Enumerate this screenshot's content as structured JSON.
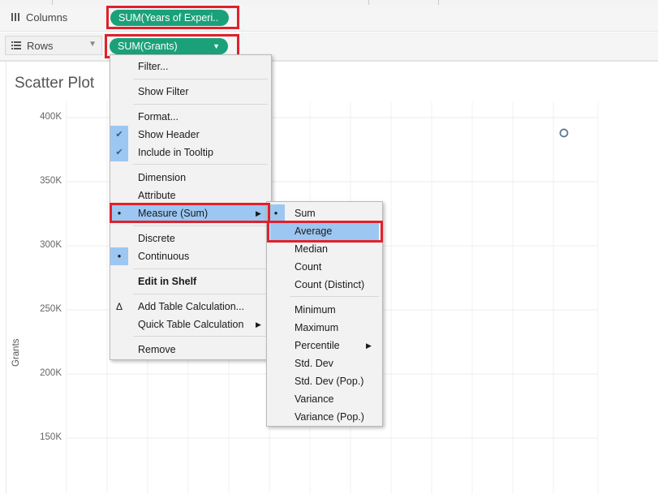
{
  "shelves": {
    "columns": {
      "label": "Columns",
      "icon": "columns-icon",
      "pill": "SUM(Years of Experi.."
    },
    "rows": {
      "label": "Rows",
      "icon": "rows-icon",
      "pill": "SUM(Grants)"
    }
  },
  "view": {
    "title": "Scatter Plot",
    "y_axis_label": "Grants"
  },
  "chart_data": {
    "type": "scatter",
    "title": "Scatter Plot",
    "ylabel": "Grants",
    "y_ticks": [
      "400K",
      "350K",
      "300K",
      "250K",
      "200K",
      "150K"
    ],
    "ylim": [
      130000,
      410000
    ],
    "points": [
      {
        "y": 388000
      }
    ],
    "grid": true
  },
  "context_menu": {
    "items": [
      {
        "label": "Filter..."
      },
      {
        "label": "Show Filter"
      },
      {
        "label": "Format..."
      },
      {
        "label": "Show Header",
        "checked": true
      },
      {
        "label": "Include in Tooltip",
        "checked": true
      },
      {
        "label": "Dimension"
      },
      {
        "label": "Attribute"
      },
      {
        "label": "Measure (Sum)",
        "selected": true,
        "submenu": true
      },
      {
        "label": "Discrete"
      },
      {
        "label": "Continuous",
        "selected": true
      },
      {
        "label": "Edit in Shelf"
      },
      {
        "label": "Add Table Calculation...",
        "icon": "delta-icon"
      },
      {
        "label": "Quick Table Calculation",
        "submenu": true
      },
      {
        "label": "Remove"
      }
    ]
  },
  "measure_submenu": {
    "items": [
      {
        "label": "Sum",
        "selected": true
      },
      {
        "label": "Average",
        "highlighted": true
      },
      {
        "label": "Median"
      },
      {
        "label": "Count"
      },
      {
        "label": "Count (Distinct)"
      },
      {
        "label": "Minimum"
      },
      {
        "label": "Maximum"
      },
      {
        "label": "Percentile",
        "submenu": true
      },
      {
        "label": "Std. Dev"
      },
      {
        "label": "Std. Dev (Pop.)"
      },
      {
        "label": "Variance"
      },
      {
        "label": "Variance (Pop.)"
      }
    ]
  },
  "colors": {
    "pill": "#1ba17a",
    "highlight": "#9cc7f2",
    "annotation": "#e0212b",
    "point": "#5f7a96"
  }
}
